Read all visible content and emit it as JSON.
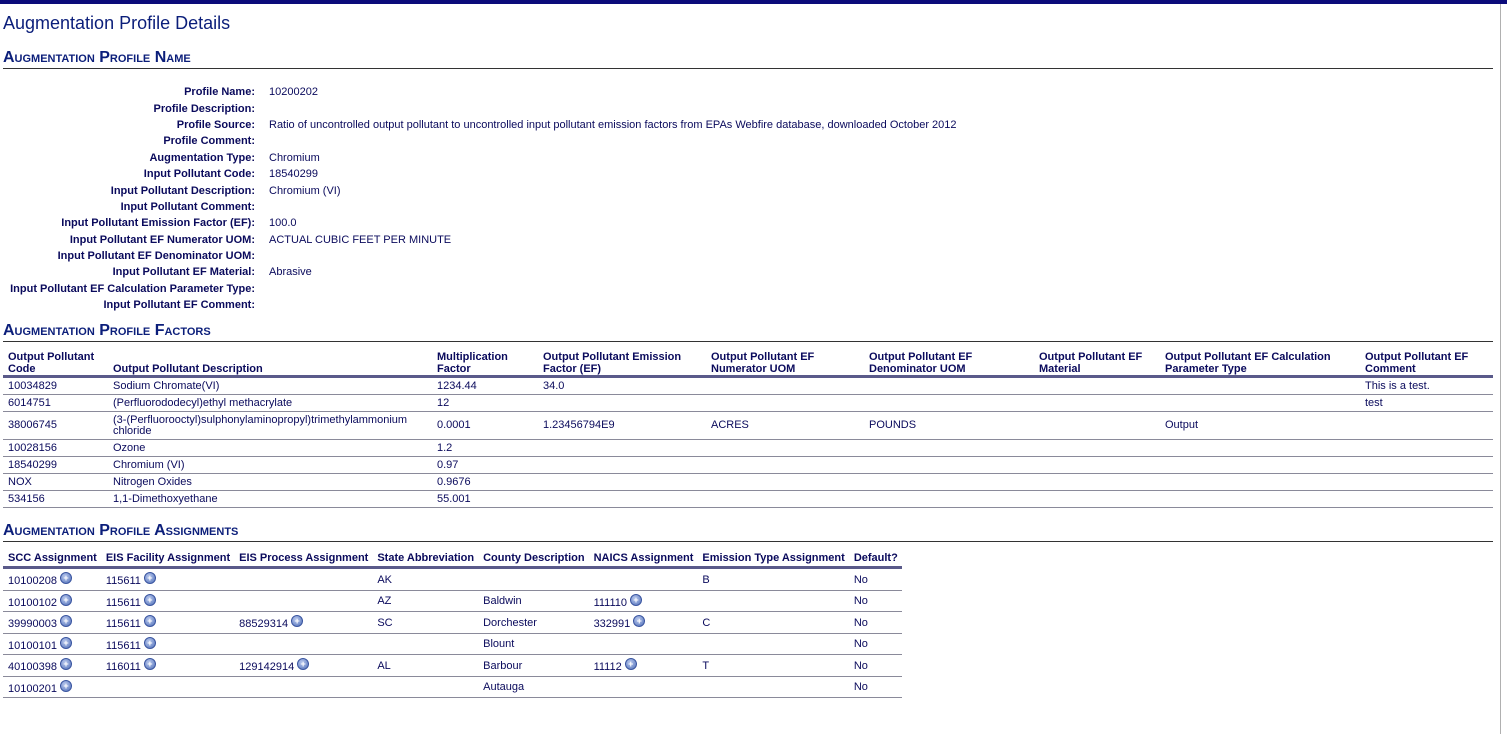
{
  "page": {
    "title": "Augmentation Profile Details"
  },
  "profile_name": {
    "heading": "Augmentation Profile Name",
    "fields": [
      {
        "label": "Profile Name:",
        "value": "10200202"
      },
      {
        "label": "Profile Description:",
        "value": ""
      },
      {
        "label": "Profile Source:",
        "value": "Ratio of uncontrolled output pollutant to uncontrolled input pollutant emission factors from EPAs Webfire database, downloaded October 2012"
      },
      {
        "label": "Profile Comment:",
        "value": ""
      },
      {
        "label": "Augmentation Type:",
        "value": "Chromium"
      },
      {
        "label": "Input Pollutant Code:",
        "value": "18540299"
      },
      {
        "label": "Input Pollutant Description:",
        "value": "Chromium (VI)"
      },
      {
        "label": "Input Pollutant Comment:",
        "value": ""
      },
      {
        "label": "Input Pollutant Emission Factor (EF):",
        "value": "100.0"
      },
      {
        "label": "Input Pollutant EF Numerator UOM:",
        "value": "ACTUAL CUBIC FEET PER MINUTE"
      },
      {
        "label": "Input Pollutant EF Denominator UOM:",
        "value": ""
      },
      {
        "label": "Input Pollutant EF Material:",
        "value": "Abrasive"
      },
      {
        "label": "Input Pollutant EF Calculation Parameter Type:",
        "value": ""
      },
      {
        "label": "Input Pollutant EF Comment:",
        "value": ""
      }
    ]
  },
  "factors": {
    "heading": "Augmentation Profile Factors",
    "columns": [
      "Output Pollutant Code",
      "Output Pollutant Description",
      "Multiplication Factor",
      "Output Pollutant Emission Factor (EF)",
      "Output Pollutant EF Numerator UOM",
      "Output Pollutant EF Denominator UOM",
      "Output Pollutant EF Material",
      "Output Pollutant EF Calculation Parameter Type",
      "Output Pollutant EF Comment"
    ],
    "rows": [
      [
        "10034829",
        "Sodium Chromate(VI)",
        "1234.44",
        "34.0",
        "",
        "",
        "",
        "",
        "This is a test."
      ],
      [
        "6014751",
        "(Perfluorododecyl)ethyl methacrylate",
        "12",
        "",
        "",
        "",
        "",
        "",
        "test"
      ],
      [
        "38006745",
        "(3-(Perfluorooctyl)sulphonylaminopropyl)trimethylammonium chloride",
        "0.0001",
        "1.23456794E9",
        "ACRES",
        "POUNDS",
        "",
        "Output",
        ""
      ],
      [
        "10028156",
        "Ozone",
        "1.2",
        "",
        "",
        "",
        "",
        "",
        ""
      ],
      [
        "18540299",
        "Chromium (VI)",
        "0.97",
        "",
        "",
        "",
        "",
        "",
        ""
      ],
      [
        "NOX",
        "Nitrogen Oxides",
        "0.9676",
        "",
        "",
        "",
        "",
        "",
        ""
      ],
      [
        "534156",
        "1,1-Dimethoxyethane",
        "55.001",
        "",
        "",
        "",
        "",
        "",
        ""
      ]
    ]
  },
  "assignments": {
    "heading": "Augmentation Profile Assignments",
    "columns": [
      "SCC Assignment",
      "EIS Facility Assignment",
      "EIS Process Assignment",
      "State Abbreviation",
      "County Description",
      "NAICS Assignment",
      "Emission Type Assignment",
      "Default?"
    ],
    "rows": [
      {
        "scc": "10100208",
        "facility": "115611",
        "process": "",
        "state": "AK",
        "county": "",
        "naics": "",
        "emission": "B",
        "default": "No"
      },
      {
        "scc": "10100102",
        "facility": "115611",
        "process": "",
        "state": "AZ",
        "county": "Baldwin",
        "naics": "111110",
        "emission": "",
        "default": "No"
      },
      {
        "scc": "39990003",
        "facility": "115611",
        "process": "88529314",
        "state": "SC",
        "county": "Dorchester",
        "naics": "332991",
        "emission": "C",
        "default": "No"
      },
      {
        "scc": "10100101",
        "facility": "115611",
        "process": "",
        "state": "",
        "county": "Blount",
        "naics": "",
        "emission": "",
        "default": "No"
      },
      {
        "scc": "40100398",
        "facility": "116011",
        "process": "129142914",
        "state": "AL",
        "county": "Barbour",
        "naics": "11112",
        "emission": "T",
        "default": "No"
      },
      {
        "scc": "10100201",
        "facility": "",
        "process": "",
        "state": "",
        "county": "Autauga",
        "naics": "",
        "emission": "",
        "default": "No"
      }
    ]
  },
  "icons": {
    "expand": "plus-circle-icon"
  },
  "colors": {
    "text": "#0a0a5c",
    "heading": "#0b1e7a",
    "topbar": "#0b0b7a"
  }
}
